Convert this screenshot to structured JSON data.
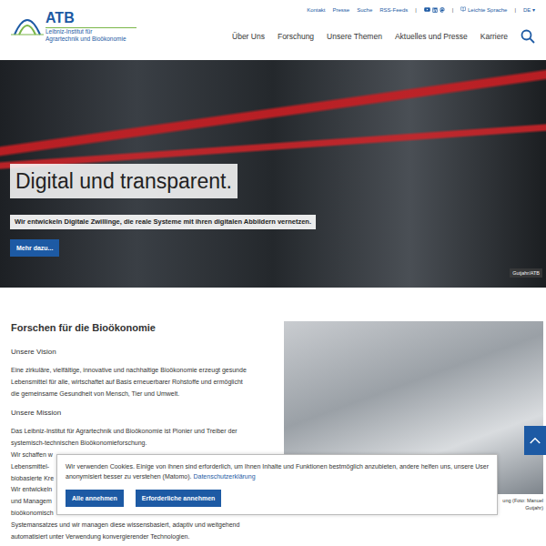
{
  "logo": {
    "abbr": "ATB",
    "subtitle": [
      "Leibniz-Institut für",
      "Agrartechnik und Bioökonomie"
    ]
  },
  "top_links": [
    "Kontakt",
    "Presse",
    "Suche",
    "RSS-Feeds"
  ],
  "separator": "|",
  "easy_language": "Leichte Sprache",
  "language": "DE",
  "language_caret": "▾",
  "nav": [
    "Über Uns",
    "Forschung",
    "Unsere Themen",
    "Aktuelles und Presse",
    "Karriere"
  ],
  "hero": {
    "title": "Digital und transparent.",
    "subtitle": "Wir entwickeln Digitale Zwillinge, die reale Systeme mit ihren digitalen Abbildern vernetzen.",
    "button": "Mehr dazu...",
    "credit": "Gutjahr/ATB"
  },
  "content": {
    "heading": "Forschen für die Bioökonomie",
    "sections": [
      {
        "title": "Unsere Vision",
        "lines": [
          "Eine zirkuläre, vielfältige, innovative und nachhaltige Bioökonomie erzeugt gesunde",
          "Lebensmittel für alle, wirtschaftet auf Basis erneuerbarer Rohstoffe und ermöglicht",
          "die gemeinsame Gesundheit von Mensch, Tier und Umwelt."
        ]
      },
      {
        "title": "Unsere Mission",
        "lines": [
          "Das Leibniz-Institut für Agrartechnik und Bioökonomie ist Pionier und Treiber der",
          "systemisch-technischen Bioökonomieforschung.",
          "Wir schaffen w",
          "Lebensmittel-",
          "biobasierte Kre",
          "Wir entwickeln",
          "und Managem",
          "bioökonomisch",
          "Systemansatzes und wir managen diese wissensbasiert, adaptiv und weitgehend",
          "automatisiert unter Verwendung konvergierender Technologien."
        ]
      }
    ]
  },
  "image_caption": "ung (Foto: Manuel Gutjahr)",
  "cookie_banner": {
    "text": "Wir verwenden Cookies. Einige von ihnen sind erforderlich, um Ihnen Inhalte und Funktionen bestmöglich anzubieten, andere helfen uns, unsere User anonymisiert besser zu verstehen (Matomo).",
    "link": "Datenschutzerklärung",
    "buttons": [
      "Alle annehmen",
      "Erforderliche annehmen"
    ]
  }
}
